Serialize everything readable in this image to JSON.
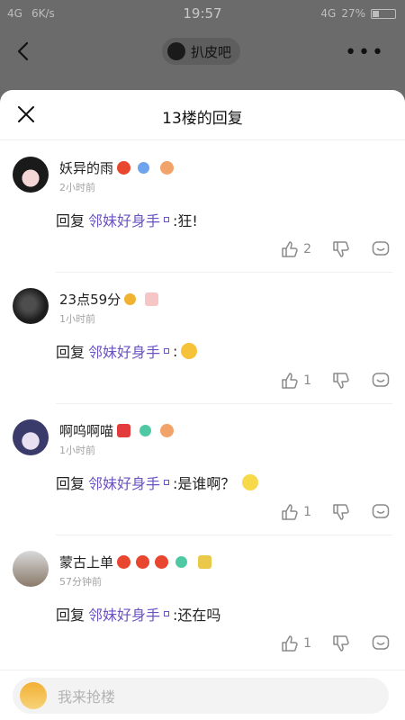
{
  "status_bar": {
    "network": "4G",
    "speed": "6K/s",
    "time": "19:57",
    "network_right": "4G",
    "battery": "27%"
  },
  "top_nav": {
    "forum_name": "扒皮吧"
  },
  "sheet": {
    "title": "13楼的回复"
  },
  "replies": [
    {
      "username": "妖异的雨",
      "time": "2小时前",
      "reply_word": "回复",
      "mention": "邻妹好身手",
      "text": ":狂!",
      "likes": "2"
    },
    {
      "username": "23点59分",
      "time": "1小时前",
      "reply_word": "回复",
      "mention": "邻妹好身手",
      "text": ":",
      "likes": "1"
    },
    {
      "username": "啊呜啊喵",
      "time": "1小时前",
      "reply_word": "回复",
      "mention": "邻妹好身手",
      "text": ":是谁啊？",
      "likes": "1"
    },
    {
      "username": "蒙古上单",
      "time": "57分钟前",
      "reply_word": "回复",
      "mention": "邻妹好身手",
      "text": ":还在吗",
      "likes": "1"
    }
  ],
  "input": {
    "placeholder": "我来抢楼"
  },
  "colors": {
    "mention": "#6a52c4",
    "overlay": "#6b6b6b"
  }
}
